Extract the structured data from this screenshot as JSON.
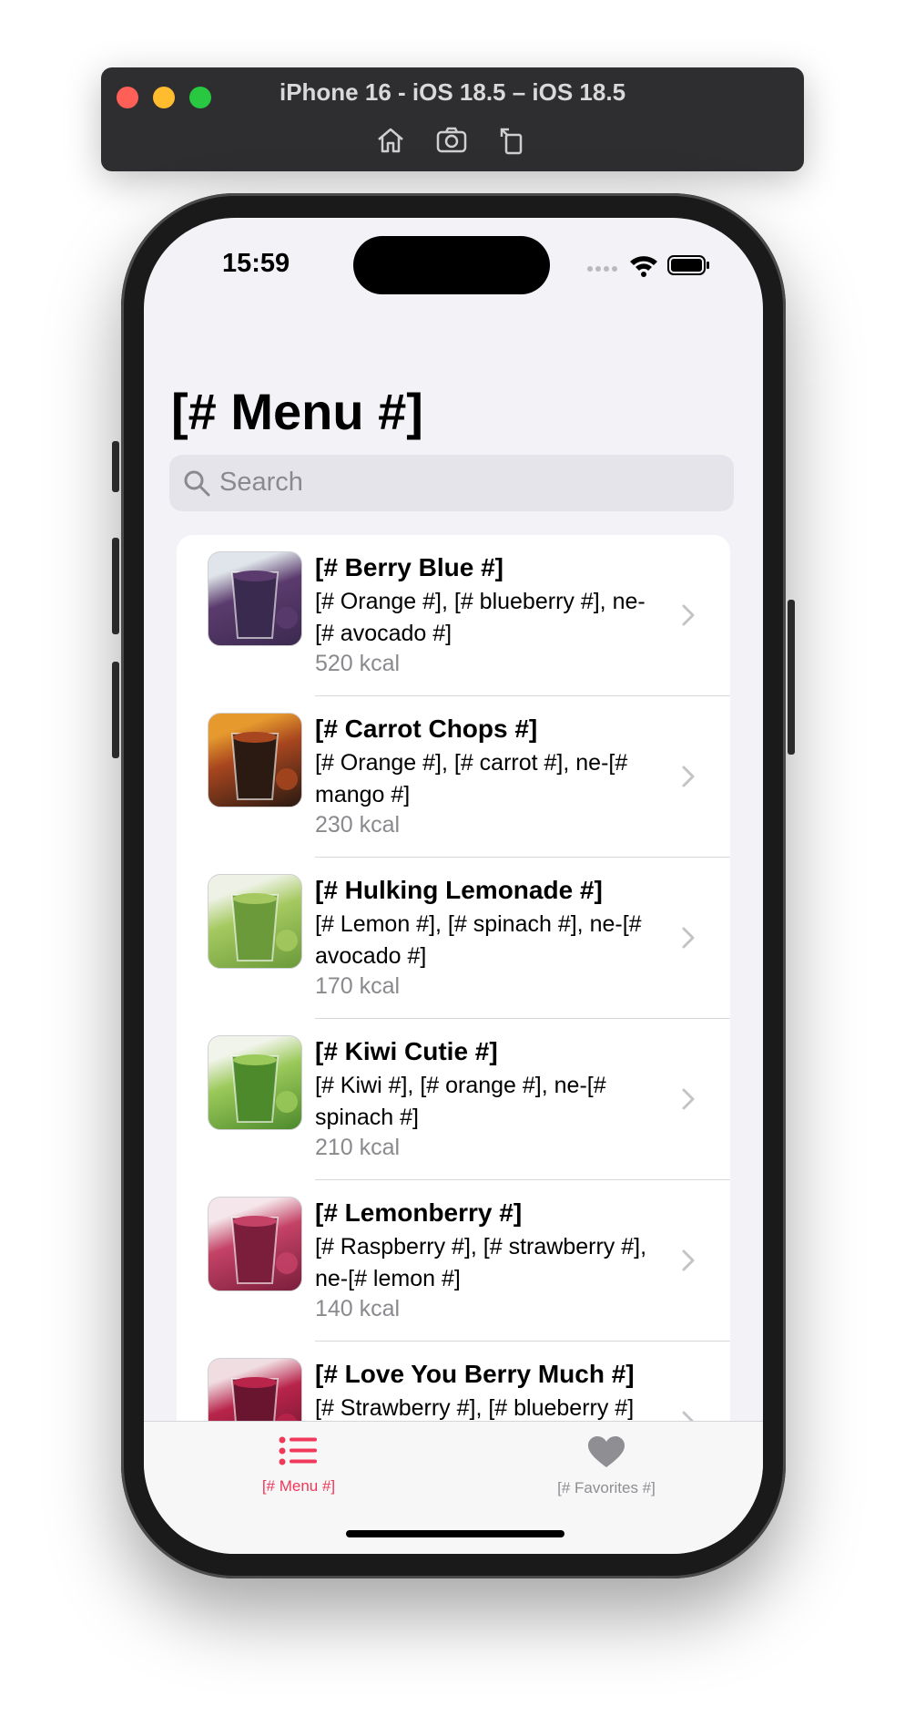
{
  "simulator": {
    "title": "iPhone 16 - iOS 18.5 – iOS 18.5",
    "tools": [
      "home-icon",
      "screenshot-icon",
      "rotate-icon"
    ]
  },
  "status_bar": {
    "time": "15:59",
    "icons": [
      "cellular-icon",
      "wifi-icon",
      "battery-icon"
    ]
  },
  "page": {
    "title": "[# Menu #]"
  },
  "search": {
    "placeholder": "Search"
  },
  "menu": [
    {
      "title": "[# Berry Blue #]",
      "ingredients": "[# Orange #], [# blueberry #], ne-[# avocado #]",
      "kcal": "520 kcal",
      "colors": [
        "#3b2a4f",
        "#5b3b6e",
        "#dfe5ea"
      ]
    },
    {
      "title": "[# Carrot Chops #]",
      "ingredients": "[# Orange #], [# carrot #], ne-[# mango #]",
      "kcal": "230 kcal",
      "colors": [
        "#2a1a12",
        "#a8461f",
        "#e69a2e"
      ]
    },
    {
      "title": "[# Hulking Lemonade #]",
      "ingredients": "[# Lemon #], [# spinach #], ne-[# avocado #]",
      "kcal": "170 kcal",
      "colors": [
        "#6b9a3a",
        "#a5c960",
        "#eef2e6"
      ]
    },
    {
      "title": "[# Kiwi Cutie #]",
      "ingredients": "[# Kiwi #], [# orange #], ne-[# spinach #]",
      "kcal": "210 kcal",
      "colors": [
        "#4d8a2c",
        "#9bc95a",
        "#f1f4ea"
      ]
    },
    {
      "title": "[# Lemonberry #]",
      "ingredients": "[# Raspberry #], [# strawberry #], ne-[# lemon #]",
      "kcal": "140 kcal",
      "colors": [
        "#7a1e3c",
        "#c44266",
        "#f4e6ea"
      ]
    },
    {
      "title": "[# Love You Berry Much #]",
      "ingredients": "[# Strawberry #], [# blueberry #]",
      "kcal": "",
      "colors": [
        "#6a1530",
        "#b8244a",
        "#f0dde2"
      ]
    }
  ],
  "tabs": [
    {
      "label": "[# Menu #]",
      "icon": "list-icon",
      "active": true
    },
    {
      "label": "[# Favorites #]",
      "icon": "heart-icon",
      "active": false
    }
  ],
  "theme": {
    "accent": "#f0385a",
    "inactive": "#8e8e93"
  }
}
